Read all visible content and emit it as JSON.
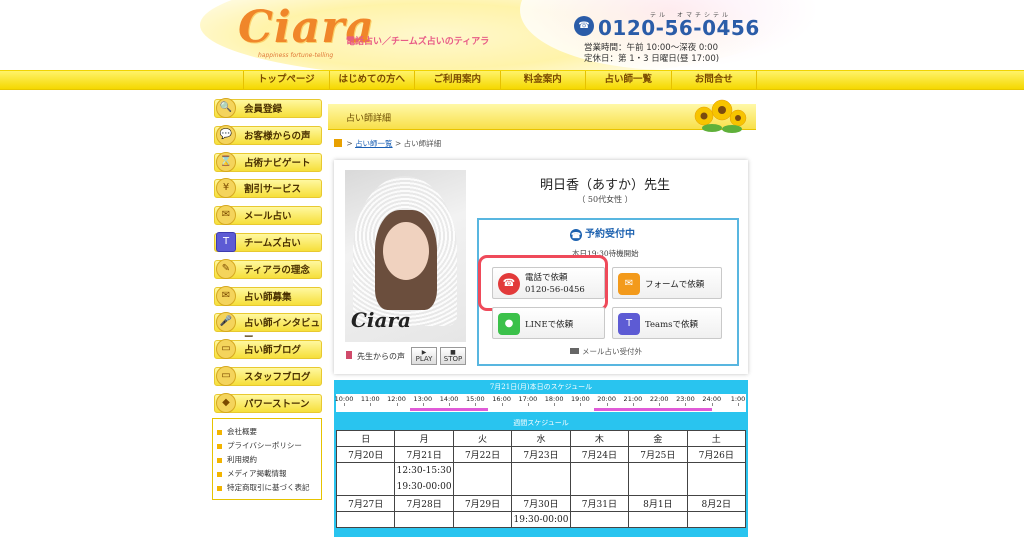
{
  "header": {
    "logo": "Ciara",
    "logo_sub": "happiness fortune-telling",
    "tagline": "電話占い／チームズ占いのティアラ",
    "phone_badge": "☎",
    "phone_kana": "テル　オマチシテル",
    "phone": "0120-56-0456",
    "hours_line1": "営業時間：午前 10:00～深夜 0:00",
    "hours_line2": "定休日：第 1・3 日曜日(昼 17:00)"
  },
  "nav": [
    "トップページ",
    "はじめての方へ",
    "ご利用案内",
    "料金案内",
    "占い師一覧",
    "お問合せ"
  ],
  "sidebar": {
    "items": [
      {
        "label": "会員登録",
        "icon": "magnifier-icon",
        "glyph": "🔍"
      },
      {
        "label": "お客様からの声",
        "icon": "speech-bubble-icon",
        "glyph": "💬"
      },
      {
        "label": "占術ナビゲート",
        "icon": "hourglass-icon",
        "glyph": "⌛"
      },
      {
        "label": "割引サービス",
        "icon": "yen-icon",
        "glyph": "¥"
      },
      {
        "label": "メール占い",
        "icon": "envelope-icon",
        "glyph": "✉"
      },
      {
        "label": "チームズ占い",
        "icon": "teams-icon",
        "glyph": "T"
      },
      {
        "label": "ティアラの理念",
        "icon": "scroll-icon",
        "glyph": "✎"
      },
      {
        "label": "占い師募集",
        "icon": "scroll-icon",
        "glyph": "✉"
      },
      {
        "label": "占い師インタビュー",
        "icon": "microphone-icon",
        "glyph": "🎤"
      },
      {
        "label": "占い師ブログ",
        "icon": "monitor-icon",
        "glyph": "▭"
      },
      {
        "label": "スタッフブログ",
        "icon": "monitor-icon",
        "glyph": "▭"
      },
      {
        "label": "パワーストーン",
        "icon": "stone-icon",
        "glyph": "◆"
      }
    ],
    "links": [
      "会社概要",
      "プライバシーポリシー",
      "利用規約",
      "メディア掲載情報",
      "特定商取引に基づく表記"
    ]
  },
  "page": {
    "title": "占い師詳細",
    "breadcrumb_link": "占い師一覧",
    "breadcrumb_sep1": " > ",
    "breadcrumb_sep2": " > ",
    "breadcrumb_current": "占い師詳細"
  },
  "teller": {
    "photo_logo": "Ciara",
    "name": "明日香（あすか）先生",
    "age": "（ 50代女性 ）",
    "voice_label": "先生からの声",
    "play_label": "PLAY",
    "stop_label": "STOP"
  },
  "booking": {
    "title": "予約受付中",
    "note": "本日19:30待機開始",
    "phone_btn_line1": "電話で依頼",
    "phone_btn_line2": "0120-56-0456",
    "form_btn": "フォームで依頼",
    "line_btn": "LINEで依頼",
    "teams_btn": "Teamsで依頼",
    "mail_note": "メール占い受付外"
  },
  "schedule": {
    "day_header": "7月21日(月)本日のスケジュール",
    "ticks": [
      "10:00",
      "11:00",
      "12:00",
      "13:00",
      "14:00",
      "15:00",
      "16:00",
      "17:00",
      "18:00",
      "19:00",
      "20:00",
      "21:00",
      "22:00",
      "23:00",
      "24:00",
      "1:00"
    ],
    "busy_ranges": [
      [
        12.5,
        15.5
      ],
      [
        19.5,
        24.0
      ]
    ],
    "week_header": "週間スケジュール",
    "weekdays": [
      "日",
      "月",
      "火",
      "水",
      "木",
      "金",
      "土"
    ],
    "week1_dates": [
      "7月20日",
      "7月21日",
      "7月22日",
      "7月23日",
      "7月24日",
      "7月25日",
      "7月26日"
    ],
    "week1_slots": [
      "",
      "12:30-15:30",
      "",
      "",
      "",
      "",
      ""
    ],
    "week1_slots2": [
      "",
      "19:30-00:00",
      "",
      "",
      "",
      "",
      ""
    ],
    "week2_dates": [
      "7月27日",
      "7月28日",
      "7月29日",
      "7月30日",
      "7月31日",
      "8月1日",
      "8月2日"
    ],
    "week2_slots": [
      "",
      "",
      "",
      "19:30-00:00",
      "",
      "",
      ""
    ]
  },
  "colors": {
    "accent_yellow": "#f5d800",
    "accent_blue": "#29c4ef",
    "highlight_red": "#ef4a5a",
    "brand_orange": "#f0862a"
  }
}
